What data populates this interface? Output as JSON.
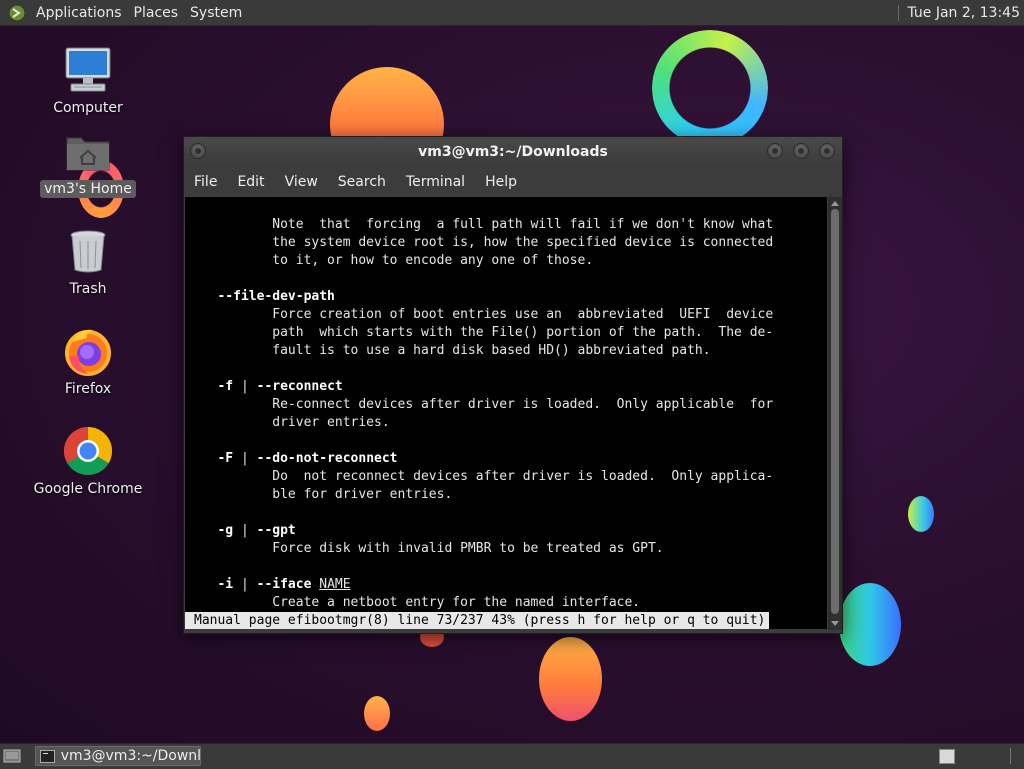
{
  "top_panel": {
    "menus": [
      "Applications",
      "Places",
      "System"
    ],
    "clock": "Tue Jan  2, 13:45"
  },
  "desktop": {
    "icons": [
      {
        "label": "Computer",
        "icon": "computer-icon"
      },
      {
        "label": "vm3's Home",
        "icon": "home-folder-icon",
        "selected": true
      },
      {
        "label": "Trash",
        "icon": "trash-icon"
      },
      {
        "label": "Firefox",
        "icon": "firefox-icon"
      },
      {
        "label": "Google Chrome",
        "icon": "chrome-icon"
      }
    ]
  },
  "terminal": {
    "title": "vm3@vm3:~/Downloads",
    "menu": [
      "File",
      "Edit",
      "View",
      "Search",
      "Terminal",
      "Help"
    ],
    "lines": [
      {
        "segments": [
          {
            "t": "          Note  that  forcing  a full path will fail if we don't know what"
          }
        ]
      },
      {
        "segments": [
          {
            "t": "          the system device root is, how the specified device is connected"
          }
        ]
      },
      {
        "segments": [
          {
            "t": "          to it, or how to encode any one of those."
          }
        ]
      },
      {
        "segments": []
      },
      {
        "segments": [
          {
            "t": "   "
          },
          {
            "t": "--file-dev-path",
            "b": true
          }
        ]
      },
      {
        "segments": [
          {
            "t": "          Force creation of boot entries use an  abbreviated  UEFI  device"
          }
        ]
      },
      {
        "segments": [
          {
            "t": "          path  which starts with the File() portion of the path.  The de-"
          }
        ]
      },
      {
        "segments": [
          {
            "t": "          fault is to use a hard disk based HD() abbreviated path."
          }
        ]
      },
      {
        "segments": []
      },
      {
        "segments": [
          {
            "t": "   "
          },
          {
            "t": "-f",
            "b": true
          },
          {
            "t": " | "
          },
          {
            "t": "--reconnect",
            "b": true
          }
        ]
      },
      {
        "segments": [
          {
            "t": "          Re-connect devices after driver is loaded.  Only applicable  for"
          }
        ]
      },
      {
        "segments": [
          {
            "t": "          driver entries."
          }
        ]
      },
      {
        "segments": []
      },
      {
        "segments": [
          {
            "t": "   "
          },
          {
            "t": "-F",
            "b": true
          },
          {
            "t": " | "
          },
          {
            "t": "--do-not-reconnect",
            "b": true
          }
        ]
      },
      {
        "segments": [
          {
            "t": "          Do  not reconnect devices after driver is loaded.  Only applica-"
          }
        ]
      },
      {
        "segments": [
          {
            "t": "          ble for driver entries."
          }
        ]
      },
      {
        "segments": []
      },
      {
        "segments": [
          {
            "t": "   "
          },
          {
            "t": "-g",
            "b": true
          },
          {
            "t": " | "
          },
          {
            "t": "--gpt",
            "b": true
          }
        ]
      },
      {
        "segments": [
          {
            "t": "          Force disk with invalid PMBR to be treated as GPT."
          }
        ]
      },
      {
        "segments": []
      },
      {
        "segments": [
          {
            "t": "   "
          },
          {
            "t": "-i",
            "b": true
          },
          {
            "t": " | "
          },
          {
            "t": "--iface",
            "b": true
          },
          {
            "t": " "
          },
          {
            "t": "NAME",
            "u": true
          }
        ]
      },
      {
        "segments": [
          {
            "t": "          Create a netboot entry for the named interface."
          }
        ]
      }
    ],
    "status": "Manual page efibootmgr(8) line 73/237 43% (press h for help or q to quit)"
  },
  "bottom_panel": {
    "task_label": "vm3@vm3:~/Downl..."
  }
}
